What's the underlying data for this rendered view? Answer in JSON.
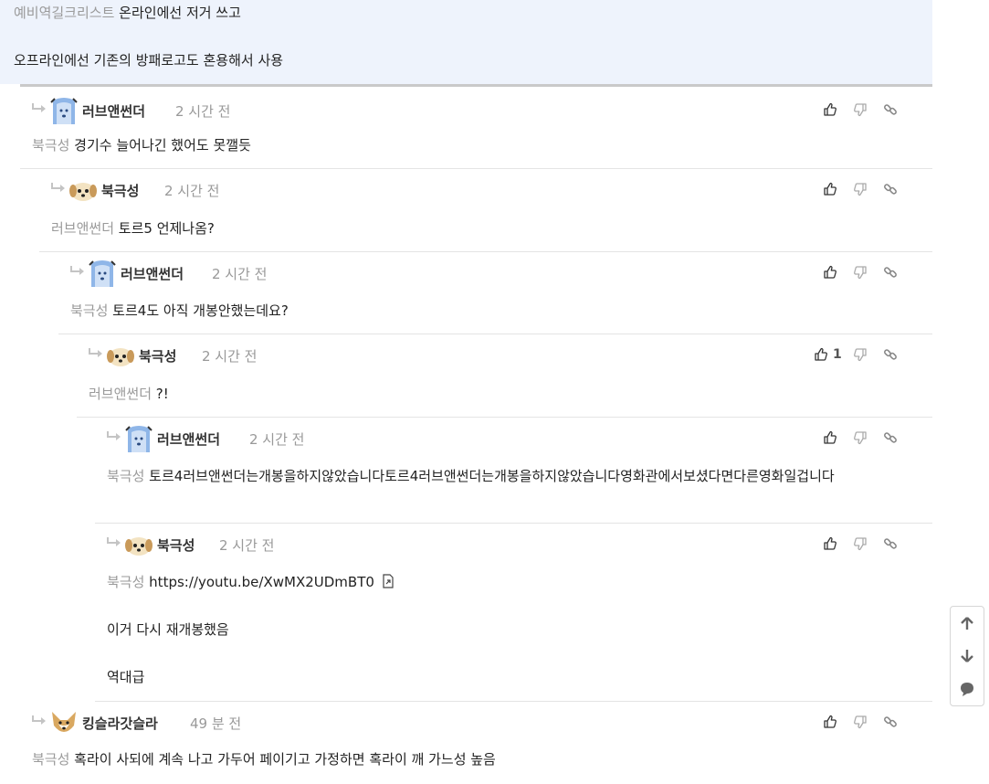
{
  "quote": {
    "line1_mention": "예비역길크리스트",
    "line1_text": " 온라인에선 저거 쓰고",
    "line2_text": "오프라인에선 기존의 방패로고도 혼용해서 사용"
  },
  "comments": [
    {
      "user": "러브앤썬더",
      "time": "2 시간 전",
      "mention": "북극성",
      "text": " 경기수 늘어나긴 했어도 못깰듯",
      "likes": ""
    },
    {
      "user": "북극성",
      "time": "2 시간 전",
      "mention": "러브앤썬더",
      "text": " 토르5 언제나옴?",
      "likes": ""
    },
    {
      "user": "러브앤썬더",
      "time": "2 시간 전",
      "mention": "북극성",
      "text": " 토르4도 아직 개봉안했는데요?",
      "likes": ""
    },
    {
      "user": "북극성",
      "time": "2 시간 전",
      "mention": "러브앤썬더",
      "text": " ?!",
      "likes": "1"
    },
    {
      "user": "러브앤썬더",
      "time": "2 시간 전",
      "mention": "북극성",
      "text": " 토르4러브앤썬더는개봉을하지않았습니다토르4러브앤썬더는개봉을하지않았습니다영화관에서보셨다면다른영화일겁니다",
      "likes": ""
    },
    {
      "user": "북극성",
      "time": "2 시간 전",
      "mention": "북극성",
      "text": " https://youtu.be/XwMX2UDmBT0",
      "line2": "이거 다시 재개봉했음",
      "line3": "역대급",
      "likes": ""
    },
    {
      "user": "킹슬라갓슬라",
      "time": "49 분 전",
      "mention": "북극성",
      "text": " 혹라이 사되에 계속 나고 가두어 페이기고 가정하면 혹라이 깨 가느성 높음",
      "likes": ""
    }
  ],
  "icons": {
    "like": "thumbs-up-icon",
    "dislike": "thumbs-down-icon",
    "link": "link-icon",
    "reply": "reply-arrow-icon",
    "external": "external-link-icon",
    "scroll_up": "arrow-up-icon",
    "scroll_down": "arrow-down-icon",
    "comments": "comment-bubble-icon"
  },
  "colors": {
    "quote_bg": "#eef3fc",
    "mention": "#9a9a9a",
    "username": "#333333",
    "time": "#999999"
  }
}
